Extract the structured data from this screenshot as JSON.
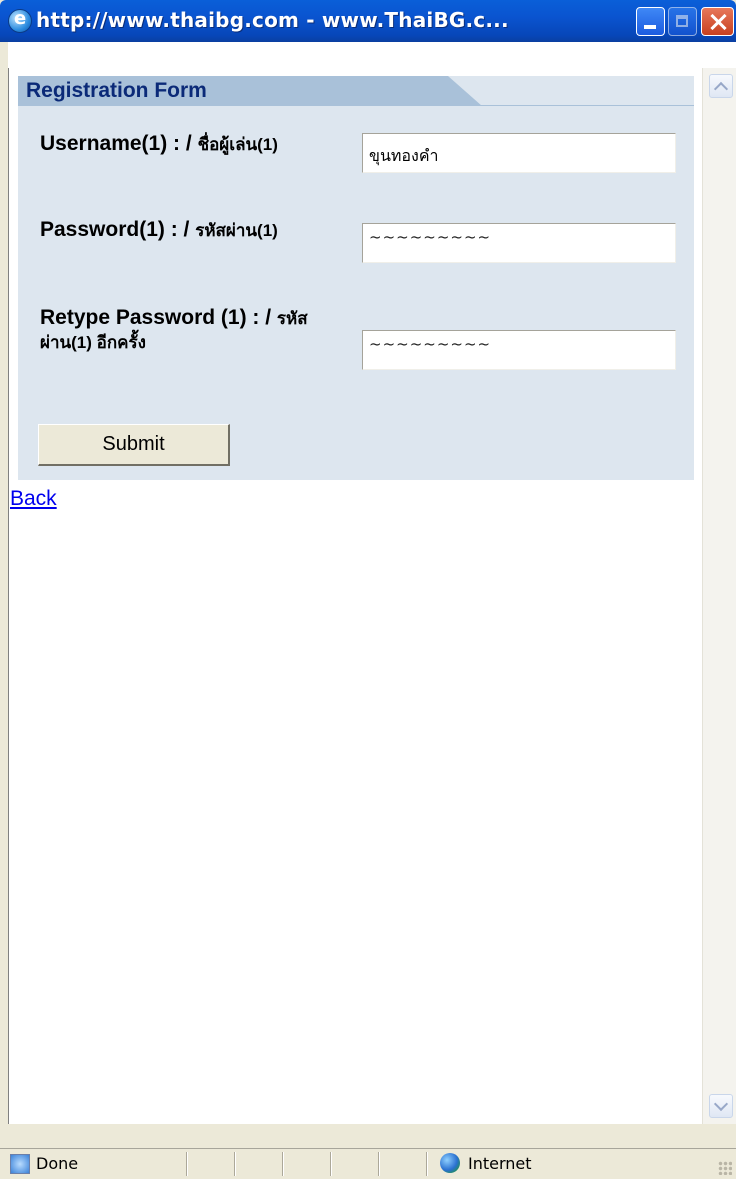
{
  "window": {
    "title": "http://www.thaibg.com - www.ThaiBG.c..."
  },
  "form": {
    "header": "Registration Form",
    "fields": [
      {
        "label": "Username(1) : / ",
        "label_thai": "ชื่อผู้เล่น(1)",
        "value": "ขุนทองคำ"
      },
      {
        "label": "Password(1) : / ",
        "label_thai": "รหัสผ่าน(1)",
        "value": "~~~~~~~~~"
      },
      {
        "label": "Retype Password (1) : / ",
        "label_thai": "รหัสผ่าน(1) อีกครั้ง",
        "value": "~~~~~~~~~"
      }
    ],
    "submit_label": "Submit"
  },
  "back_link": "Back",
  "status": {
    "text": "Done",
    "zone": "Internet"
  },
  "icons": {
    "title": "ie-page-icon",
    "status": "ie-page-icon",
    "zone": "internet-globe-icon"
  }
}
